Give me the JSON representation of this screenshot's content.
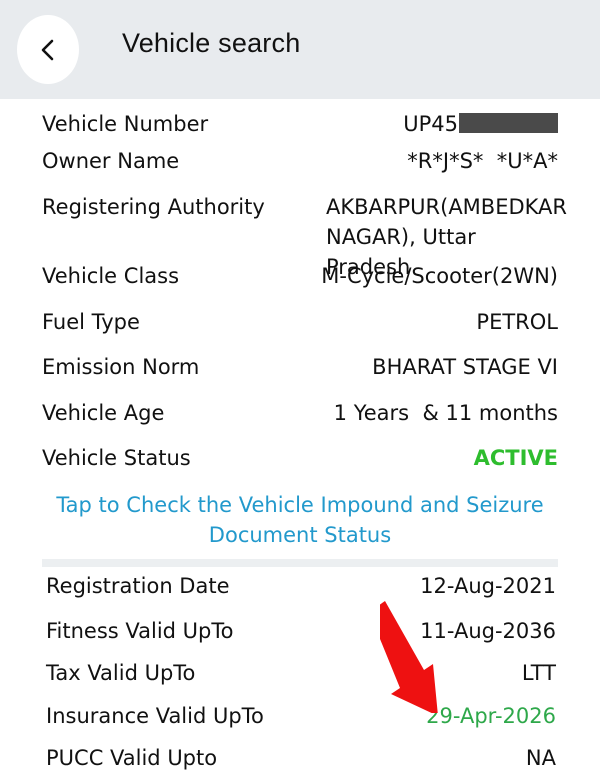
{
  "app_bar": {
    "title": "Vehicle search",
    "back_icon": "chevron-left-icon"
  },
  "vehicle_details": {
    "vehicle_number": {
      "label": "Vehicle Number",
      "value_prefix": "UP45",
      "redacted": true
    },
    "owner_name": {
      "label": "Owner Name",
      "value": "*R*J*S*  *U*A*"
    },
    "registering_authority": {
      "label": "Registering Authority",
      "value": "AKBARPUR(AMBEDKAR NAGAR), Uttar Pradesh"
    },
    "vehicle_class": {
      "label": "Vehicle Class",
      "value": "M-Cycle/Scooter(2WN)"
    },
    "fuel_type": {
      "label": "Fuel Type",
      "value": "PETROL"
    },
    "emission_norm": {
      "label": "Emission Norm",
      "value": "BHARAT STAGE VI"
    },
    "vehicle_age": {
      "label": "Vehicle Age",
      "value": "1 Years  & 11 months"
    },
    "vehicle_status": {
      "label": "Vehicle Status",
      "value": "ACTIVE"
    }
  },
  "impound_link": {
    "text": "Tap to Check the Vehicle Impound and Seizure Document Status"
  },
  "validity": {
    "registration_date": {
      "label": "Registration Date",
      "value": "12-Aug-2021"
    },
    "fitness_valid": {
      "label": "Fitness Valid UpTo",
      "value": "11-Aug-2036"
    },
    "tax_valid": {
      "label": "Tax Valid UpTo",
      "value": "LTT"
    },
    "insurance_valid": {
      "label": "Insurance Valid UpTo",
      "value": "29-Apr-2026"
    },
    "pucc_valid": {
      "label": "PUCC Valid Upto",
      "value": "NA"
    }
  },
  "colors": {
    "app_bar_bg": "#e8ebee",
    "active_green": "#2ebd2e",
    "insurance_green": "#2ea84a",
    "link_blue": "#2299cc",
    "annotation_red": "#ee1111"
  }
}
